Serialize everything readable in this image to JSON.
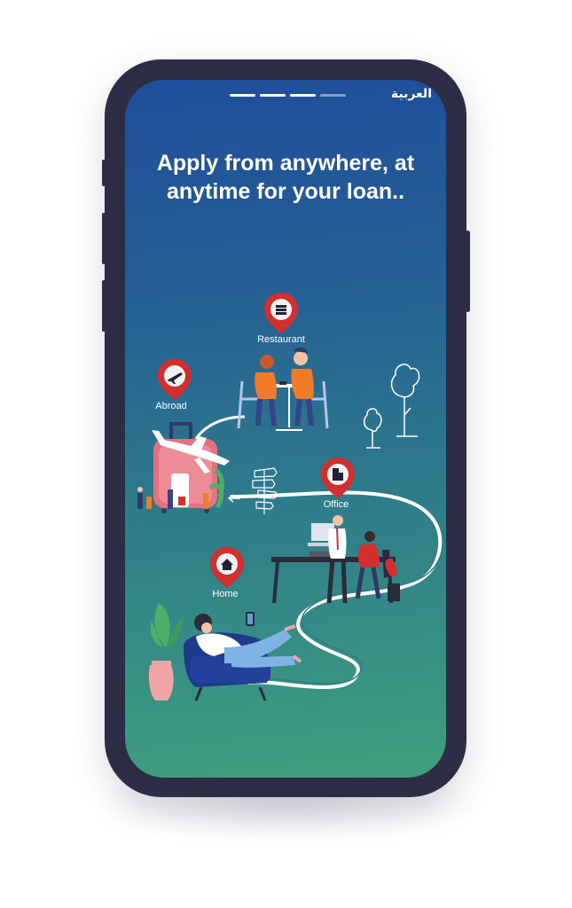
{
  "header": {
    "language_toggle": "العربية"
  },
  "pager": {
    "count": 4,
    "active_index": 2
  },
  "headline": {
    "line1": "Apply from anywhere, at",
    "line2": "anytime for your loan.."
  },
  "locations": [
    {
      "label": "Restaurant",
      "icon": "restaurant-icon"
    },
    {
      "label": "Abroad",
      "icon": "airplane-icon"
    },
    {
      "label": "Office",
      "icon": "office-building-icon"
    },
    {
      "label": "Home",
      "icon": "home-icon"
    }
  ],
  "colors": {
    "pin_red": "#d32f2f",
    "gradient_top": "#1f4e9a",
    "gradient_bottom": "#3fa07d",
    "orange": "#f07c2a"
  }
}
